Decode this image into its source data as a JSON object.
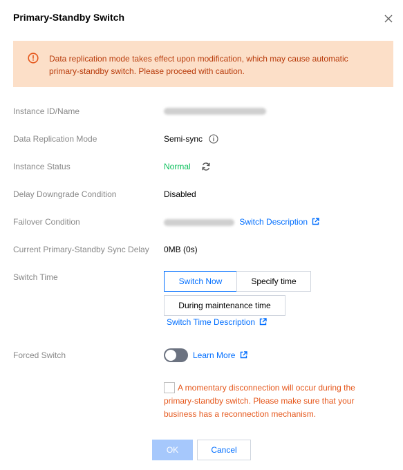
{
  "dialog": {
    "title": "Primary-Standby Switch",
    "close_icon": "close-icon"
  },
  "alert": {
    "icon": "warning-circle-icon",
    "text": "Data replication mode takes effect upon modification, which may cause automatic primary-standby switch. Please proceed with caution."
  },
  "rows": {
    "instance_id_label": "Instance ID/Name",
    "replication_mode_label": "Data Replication Mode",
    "replication_mode_value": "Semi-sync",
    "status_label": "Instance Status",
    "status_value": "Normal",
    "delay_downgrade_label": "Delay Downgrade Condition",
    "delay_downgrade_value": "Disabled",
    "failover_label": "Failover Condition",
    "failover_link": "Switch Description",
    "sync_delay_label": "Current Primary-Standby Sync Delay",
    "sync_delay_value": "0MB (0s)",
    "switch_time_label": "Switch Time",
    "forced_switch_label": "Forced Switch"
  },
  "switch_time": {
    "options": [
      "Switch Now",
      "Specify time",
      "During maintenance time"
    ],
    "selected": "Switch Now",
    "description_link": "Switch Time Description"
  },
  "forced_switch": {
    "enabled": false,
    "learn_more": "Learn More"
  },
  "warning": {
    "text": "A momentary disconnection will occur during the primary-standby switch. Please make sure that your business has a reconnection mechanism."
  },
  "footer": {
    "ok_label": "OK",
    "cancel_label": "Cancel"
  },
  "colors": {
    "accent": "#006eff",
    "status_ok": "#0abf5b",
    "alert_bg": "#fcdfc8",
    "alert_text": "#b83b0b",
    "warn_text": "#e5561a"
  }
}
